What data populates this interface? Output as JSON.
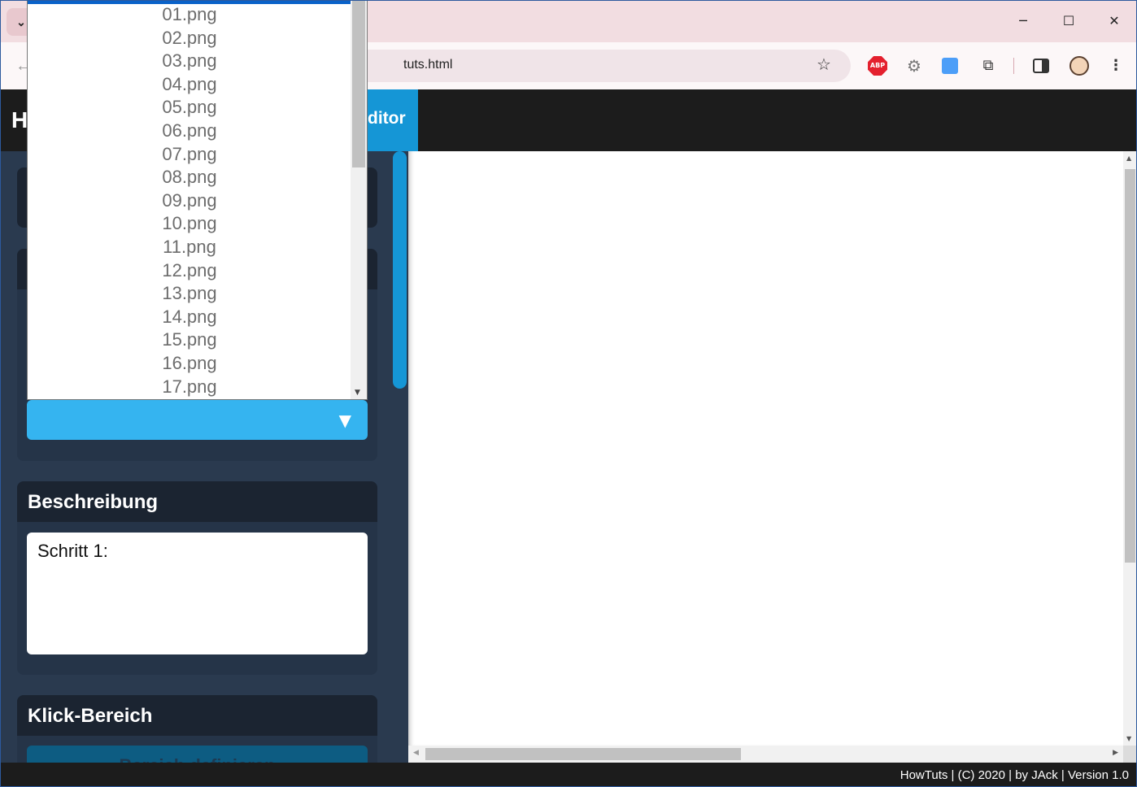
{
  "browser": {
    "tab_menu_icon": "chevron-down-icon",
    "tab_menu_glyph": "⌄",
    "window_controls": {
      "minimize": "─",
      "maximize": "☐",
      "close": "✕"
    },
    "back_glyph": "←",
    "url": "tuts.html",
    "star_glyph": "☆",
    "extensions": {
      "abp_label": "ABP",
      "gear_glyph": "⚙",
      "puzzle_glyph": "⧉",
      "kebab_glyph": "⋮"
    }
  },
  "app": {
    "title_partial": "H",
    "nav_active_label": "ditor",
    "accent_color": "#1596d6"
  },
  "left_panel": {
    "description_card": {
      "title": "Beschreibung",
      "text": "Schritt 1:"
    },
    "select_arrow": "▼",
    "click_area_card": {
      "title": "Klick-Bereich",
      "button_label": "Bereich definieren"
    }
  },
  "dropdown": {
    "options": [
      "01.png",
      "02.png",
      "03.png",
      "04.png",
      "05.png",
      "06.png",
      "07.png",
      "08.png",
      "09.png",
      "10.png",
      "11.png",
      "12.png",
      "13.png",
      "14.png",
      "15.png",
      "16.png",
      "17.png"
    ]
  },
  "footer": {
    "text": "HowTuts | (C) 2020 | by JAck | Version 1.0"
  }
}
